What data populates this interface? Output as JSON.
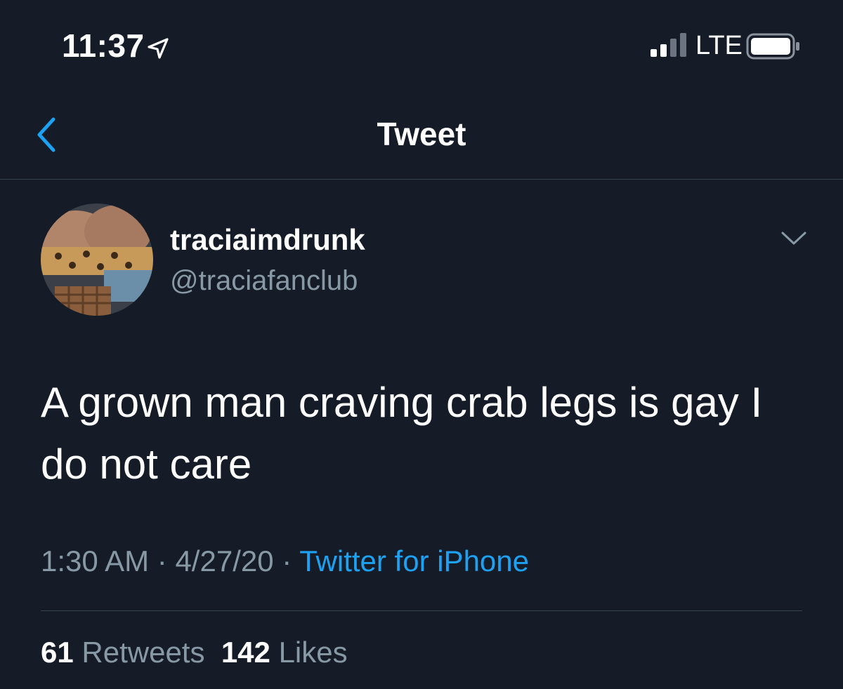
{
  "status_bar": {
    "time": "11:37",
    "network": "LTE",
    "location_icon": "location-arrow-icon",
    "signal_icon": "cellular-signal-icon",
    "battery_icon": "battery-icon"
  },
  "nav": {
    "title": "Tweet",
    "back_icon": "chevron-left-icon"
  },
  "tweet": {
    "display_name": "traciaimdrunk",
    "handle": "@traciafanclub",
    "text": "A grown man craving crab legs is gay I do not care",
    "time": "1:30 AM",
    "date": "4/27/20",
    "separator": "·",
    "source": "Twitter for iPhone",
    "retweets_count": "61",
    "retweets_label": "Retweets",
    "likes_count": "142",
    "likes_label": "Likes"
  },
  "colors": {
    "background": "#151c27",
    "accent": "#1da1f2",
    "secondary_text": "#8899a6",
    "divider": "#38444d"
  }
}
